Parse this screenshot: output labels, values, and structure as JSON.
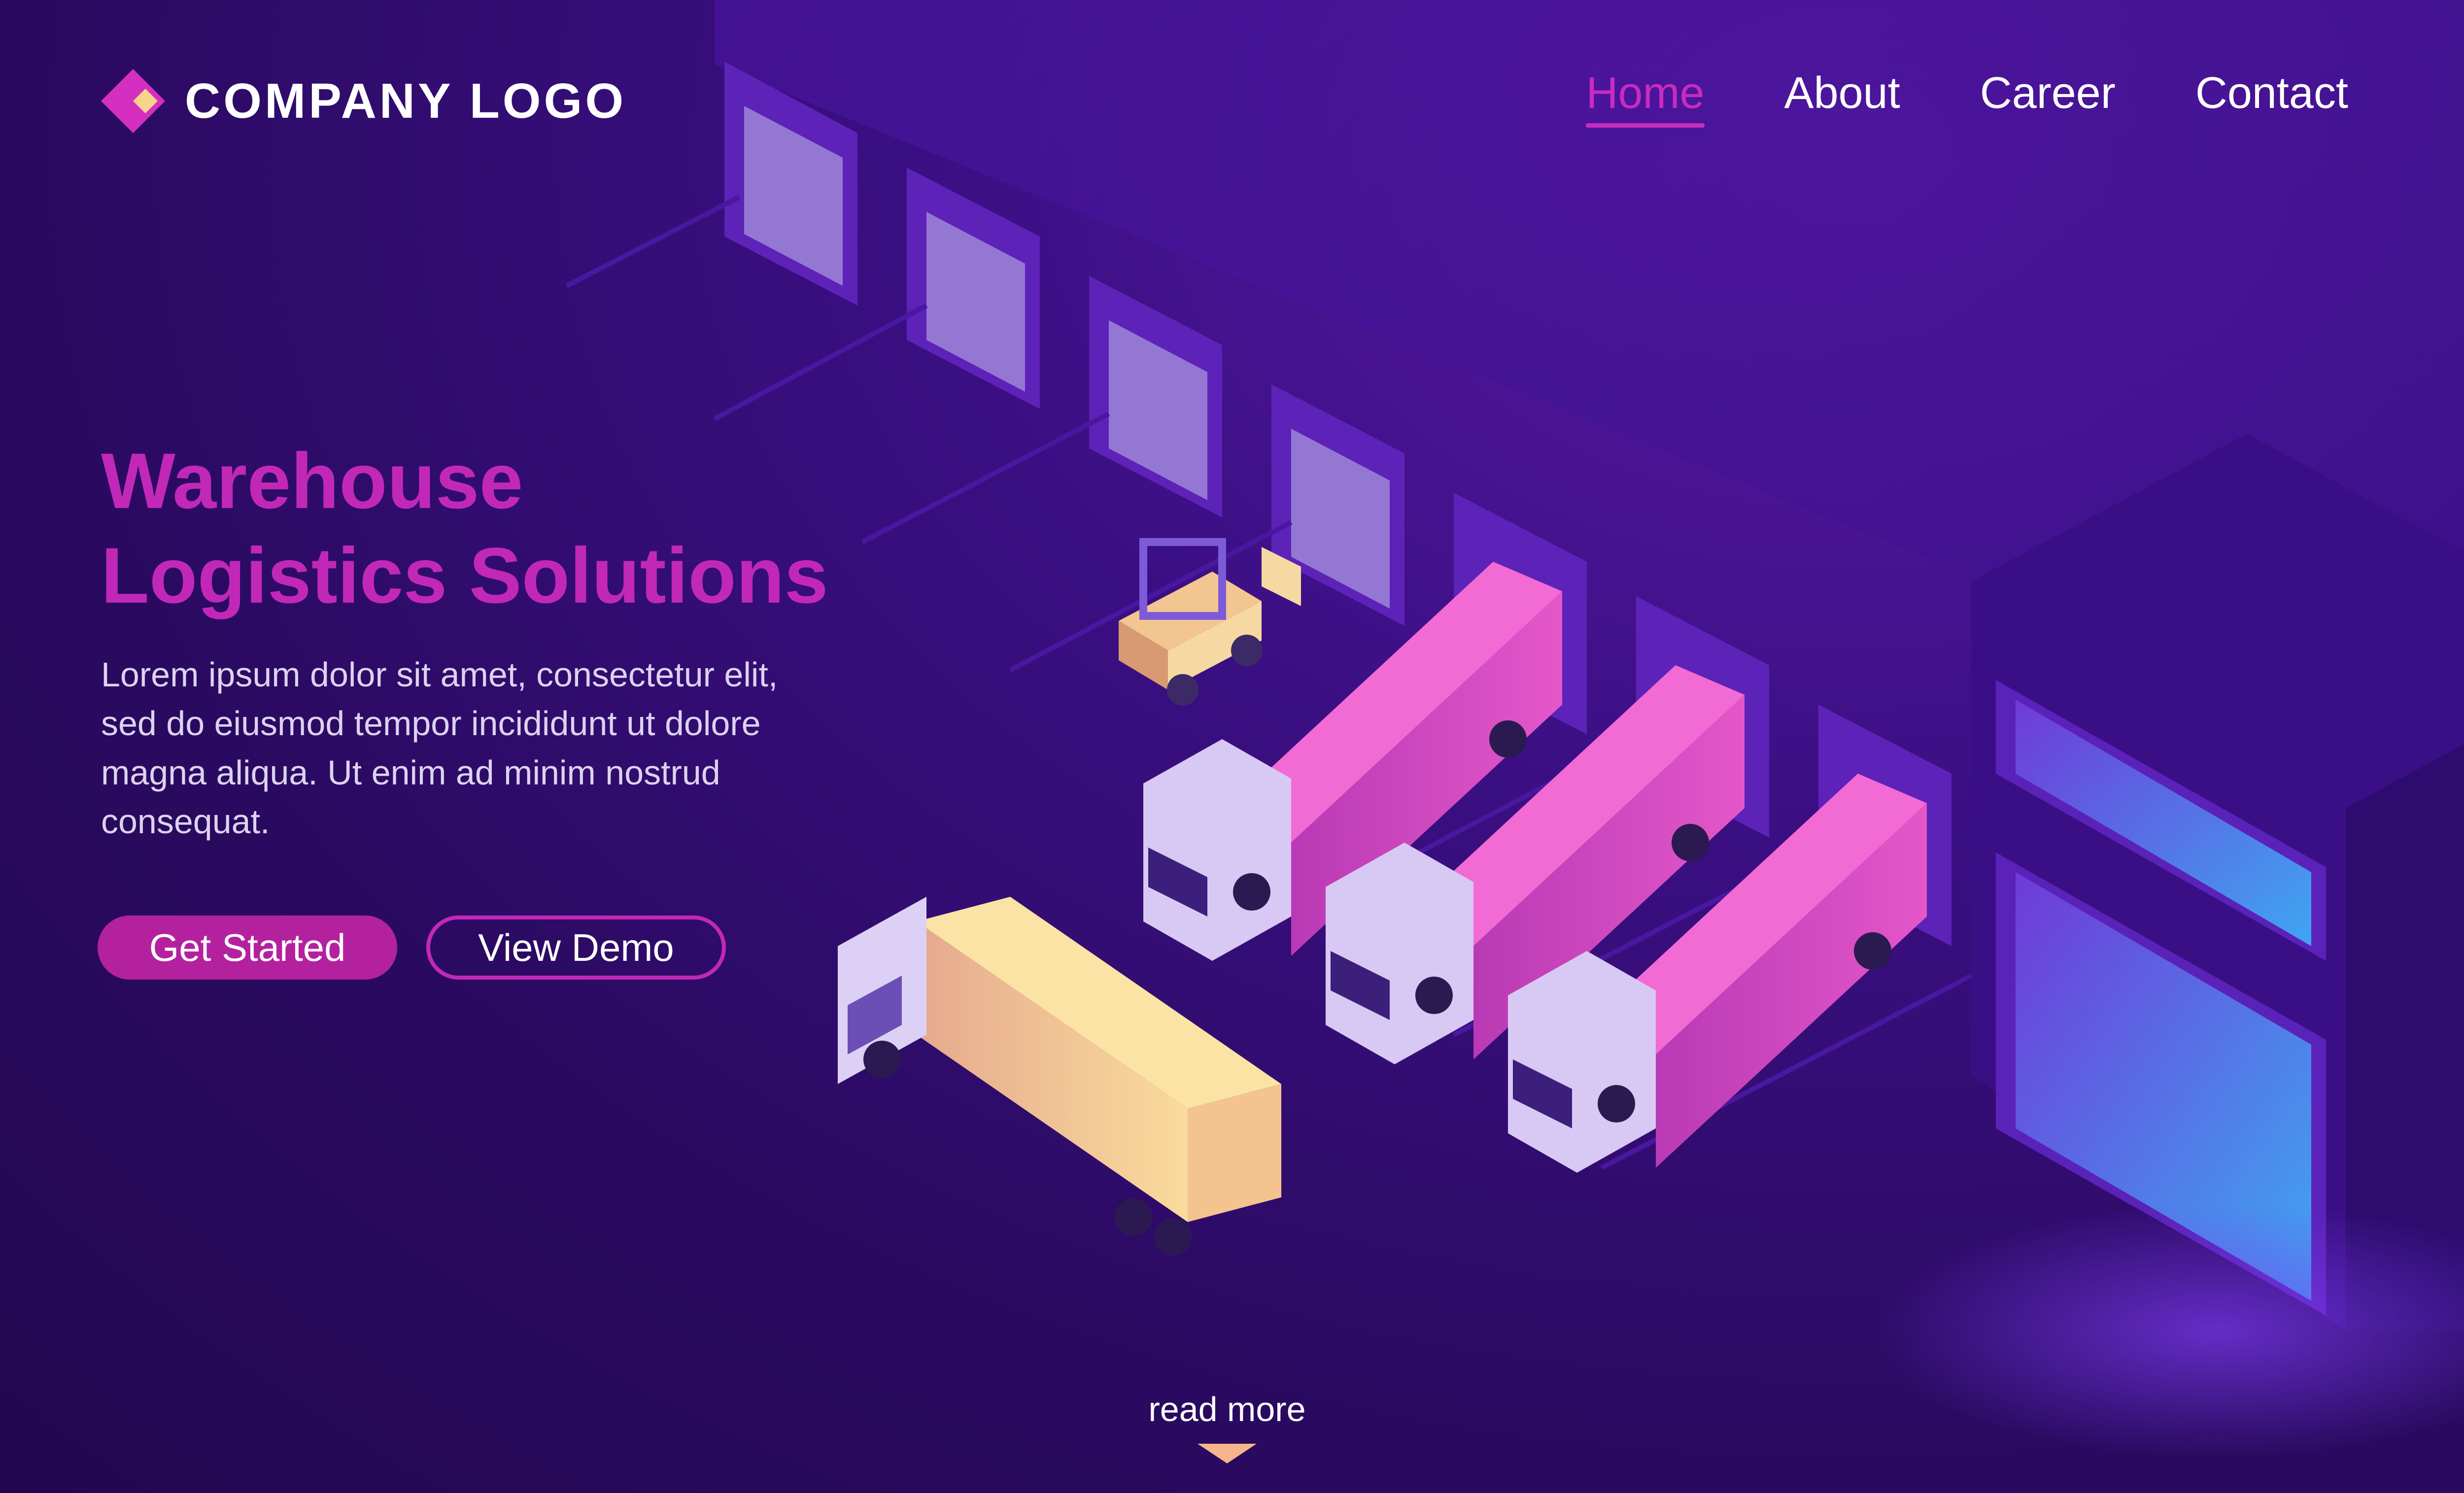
{
  "header": {
    "logo_text": "COMPANY LOGO",
    "logo_icon": "diamond-logo-icon",
    "nav": [
      {
        "label": "Home",
        "active": true
      },
      {
        "label": "About",
        "active": false
      },
      {
        "label": "Career",
        "active": false
      },
      {
        "label": "Contact",
        "active": false
      }
    ]
  },
  "hero": {
    "title_line1": "Warehouse",
    "title_line2": "Logistics Solutions",
    "description": "Lorem ipsum dolor sit amet, consectetur elit, sed do eiusmod tempor incididunt ut dolore magna aliqua. Ut enim ad minim nostrud consequat.",
    "primary_button": "Get Started",
    "secondary_button": "View Demo"
  },
  "footer": {
    "read_more": "read more",
    "arrow_icon": "chevron-down-icon"
  },
  "colors": {
    "accent": "#c228b8",
    "background": "#2a0a60",
    "truck_container_pink": "#e24fc9",
    "truck_container_yellow": "#f6c892"
  }
}
